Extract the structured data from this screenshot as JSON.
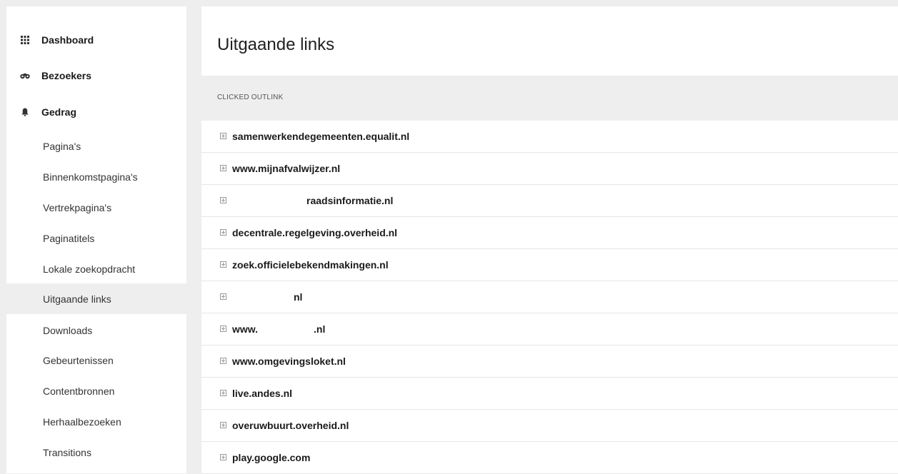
{
  "sidebar": {
    "top_items": [
      {
        "label": "Dashboard",
        "icon": "grid-icon"
      },
      {
        "label": "Bezoekers",
        "icon": "binoculars-icon"
      },
      {
        "label": "Gedrag",
        "icon": "bell-icon"
      }
    ],
    "sub_items": [
      {
        "label": "Pagina's"
      },
      {
        "label": "Binnenkomstpagina's"
      },
      {
        "label": "Vertrekpagina's"
      },
      {
        "label": "Paginatitels"
      },
      {
        "label": "Lokale zoekopdracht"
      },
      {
        "label": "Uitgaande links",
        "active": true
      },
      {
        "label": "Downloads"
      },
      {
        "label": "Gebeurtenissen"
      },
      {
        "label": "Contentbronnen"
      },
      {
        "label": "Herhaalbezoeken"
      },
      {
        "label": "Transitions"
      }
    ]
  },
  "main": {
    "title": "Uitgaande links",
    "column_header": "CLICKED OUTLINK",
    "rows": [
      {
        "url": "samenwerkendegemeenten.equalit.nl"
      },
      {
        "url": "www.mijnafvalwijzer.nl"
      },
      {
        "url": "raadsinformatie.nl",
        "redacted": true
      },
      {
        "url": "decentrale.regelgeving.overheid.nl"
      },
      {
        "url": "zoek.officielebekendmakingen.nl"
      },
      {
        "url": "nl",
        "redacted": true
      },
      {
        "url": "www.",
        "url_end": ".nl",
        "redacted": true
      },
      {
        "url": "www.omgevingsloket.nl"
      },
      {
        "url": "live.andes.nl"
      },
      {
        "url": "overuwbuurt.overheid.nl"
      },
      {
        "url": "play.google.com"
      }
    ]
  }
}
